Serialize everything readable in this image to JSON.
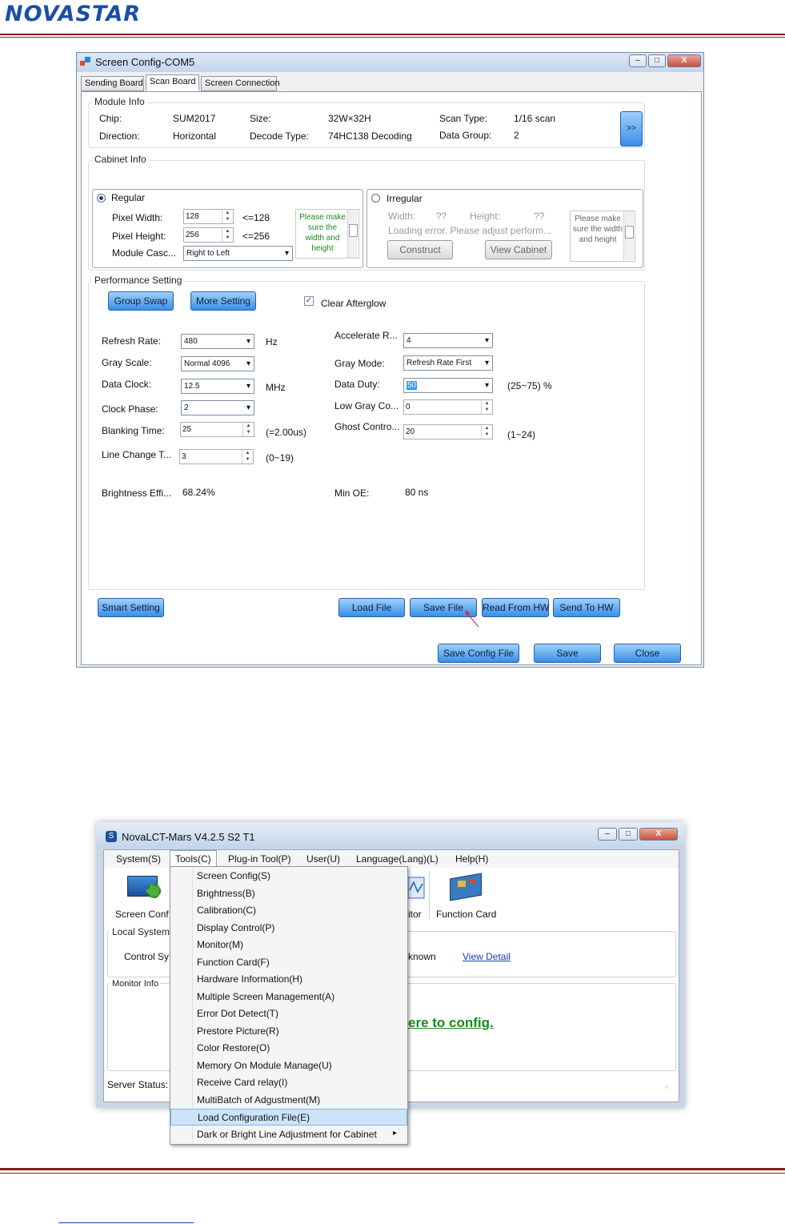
{
  "header": {
    "logo": "NOVASTAR"
  },
  "screen_config": {
    "title": "Screen Config-COM5",
    "window_buttons": {
      "minimize": "‒",
      "maximize": "□",
      "close": "X"
    },
    "tabs": [
      "Sending Board",
      "Scan Board",
      "Screen Connection"
    ],
    "module_info": {
      "title": "Module Info",
      "chip_label": "Chip:",
      "chip": "SUM2017",
      "size_label": "Size:",
      "size": "32W×32H",
      "scan_type_label": "Scan Type:",
      "scan_type": "1/16 scan",
      "direction_label": "Direction:",
      "direction": "Horizontal",
      "decode_label": "Decode Type:",
      "decode": "74HC138 Decoding",
      "data_group_label": "Data Group:",
      "data_group": "2",
      "more_button": ">>"
    },
    "cabinet_info": {
      "title": "Cabinet Info",
      "regular": "Regular",
      "pixel_width_label": "Pixel Width:",
      "pixel_width": "128",
      "pixel_width_limit": "<=128",
      "pixel_height_label": "Pixel Height:",
      "pixel_height": "256",
      "pixel_height_limit": "<=256",
      "module_cascade_label": "Module Casc...",
      "module_cascade": "Right to Left",
      "note_regular": "Please make sure the width and height",
      "irregular": "Irregular",
      "width_label": "Width:",
      "width_value": "??",
      "height_label": "Height:",
      "height_value": "??",
      "loading_error": "Loading error. Please adjust perform...",
      "construct": "Construct",
      "view_cabinet": "View Cabinet",
      "note_irregular": "Please make sure the width and height"
    },
    "performance": {
      "title": "Performance Setting",
      "group_swap": "Group Swap",
      "more_setting": "More Setting",
      "clear_afterglow": "Clear Afterglow",
      "refresh_rate_label": "Refresh Rate:",
      "refresh_rate": "480",
      "refresh_unit": "Hz",
      "gray_scale_label": "Gray Scale:",
      "gray_scale": "Normal 4096",
      "data_clock_label": "Data Clock:",
      "data_clock": "12.5",
      "data_clock_unit": "MHz",
      "clock_phase_label": "Clock Phase:",
      "clock_phase": "2",
      "blanking_label": "Blanking Time:",
      "blanking": "25",
      "blanking_note": "(=2.00us)",
      "line_change_label": "Line Change T...",
      "line_change": "3",
      "line_change_note": "(0~19)",
      "accelerate_label": "Accelerate R...",
      "accelerate": "4",
      "gray_mode_label": "Gray Mode:",
      "gray_mode": "Refresh Rate First",
      "data_duty_label": "Data Duty:",
      "data_duty": "50",
      "data_duty_note": "(25~75) %",
      "low_gray_label": "Low Gray Co...",
      "low_gray": "0",
      "ghost_label": "Ghost Contro...",
      "ghost": "20",
      "ghost_note": "(1~24)",
      "brightness_eff_label": "Brightness Effi...",
      "brightness_eff": "68.24%",
      "min_oe_label": "Min OE:",
      "min_oe": "80 ns"
    },
    "buttons": {
      "smart_setting": "Smart Setting",
      "load_file": "Load File",
      "save_file": "Save File",
      "read_from_hw": "Read From HW",
      "send_to_hw": "Send To HW",
      "save_config_file": "Save Config File",
      "save": "Save",
      "close": "Close"
    }
  },
  "nova_lct": {
    "title": "NovaLCT-Mars V4.2.5 S2 T1",
    "menu": [
      "System(S)",
      "Tools(C)",
      "Plug-in Tool(P)",
      "User(U)",
      "Language(Lang)(L)",
      "Help(H)"
    ],
    "toolbar": {
      "screen_config": "Screen Conf",
      "monitor": "itor",
      "function_card": "Function Card"
    },
    "local_system": "Local System",
    "control_sys": "Control Sy",
    "unknown": "known",
    "view_detail": "View Detail",
    "monitor_info": "Monitor Info",
    "config_link": "ere to config.",
    "server_status": "Server Status:",
    "tools_menu": [
      "Screen Config(S)",
      "Brightness(B)",
      "Calibration(C)",
      "Display Control(P)",
      "Monitor(M)",
      "Function Card(F)",
      "Hardware Information(H)",
      "Multiple Screen Management(A)",
      "Error Dot Detect(T)",
      "Prestore Picture(R)",
      "Color Restore(O)",
      "Memory On Module Manage(U)",
      "Receive Card relay(I)",
      "MultiBatch of Adgustment(M)",
      "Load Configuration File(E)",
      "Dark or Bright Line Adjustment for Cabinet"
    ],
    "submenu_arrow": "▸"
  },
  "colors": {
    "accent": "#3a8ee6",
    "header_rule": "#8b1a1a",
    "link": "#1a3fb8",
    "config_link": "#1d8a1d"
  }
}
